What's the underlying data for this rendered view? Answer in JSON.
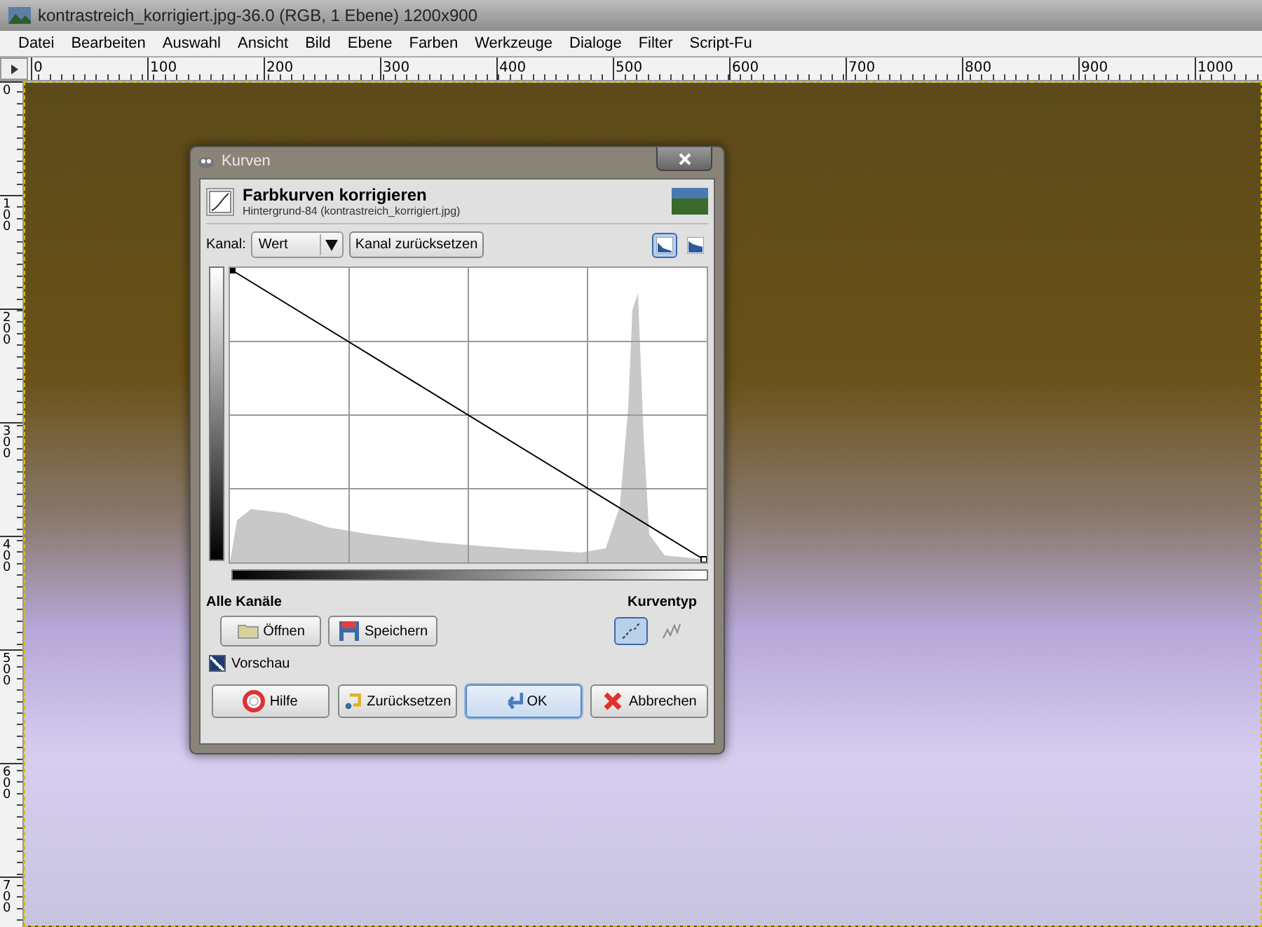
{
  "window": {
    "title": "kontrastreich_korrigiert.jpg-36.0 (RGB, 1 Ebene) 1200x900"
  },
  "menu": [
    "Datei",
    "Bearbeiten",
    "Auswahl",
    "Ansicht",
    "Bild",
    "Ebene",
    "Farben",
    "Werkzeuge",
    "Dialoge",
    "Filter",
    "Script-Fu"
  ],
  "rulers": {
    "horizontal": [
      "0",
      "100",
      "200",
      "300",
      "400",
      "500",
      "600",
      "700",
      "800",
      "900",
      "1000"
    ],
    "vertical": [
      "0",
      "100",
      "200",
      "300",
      "400",
      "500",
      "600",
      "700"
    ]
  },
  "dialog": {
    "title": "Kurven",
    "heading": "Farbkurven korrigieren",
    "subtitle": "Hintergrund-84 (kontrastreich_korrigiert.jpg)",
    "channel_label": "Kanal:",
    "channel_value": "Wert",
    "reset_channel_button": "Kanal zurücksetzen",
    "histogram_modes": [
      {
        "selected": true
      },
      {
        "selected": false
      }
    ],
    "section_label": "Alle Kanäle",
    "curve_type_label": "Kurventyp",
    "file_buttons": [
      {
        "label": "Öffnen",
        "kind": "folder"
      },
      {
        "label": "Speichern",
        "kind": "disk"
      }
    ],
    "curve_types": [
      {
        "selected": true
      },
      {
        "selected": false
      }
    ],
    "preview": {
      "label": "Vorschau",
      "checked": true
    },
    "buttons": [
      {
        "label": "Hilfe",
        "kind": "help",
        "default": false
      },
      {
        "label": "Zurücksetzen",
        "kind": "reset",
        "default": false
      },
      {
        "label": "OK",
        "kind": "ok",
        "default": true
      },
      {
        "label": "Abbrechen",
        "kind": "cancel",
        "default": false
      }
    ]
  }
}
